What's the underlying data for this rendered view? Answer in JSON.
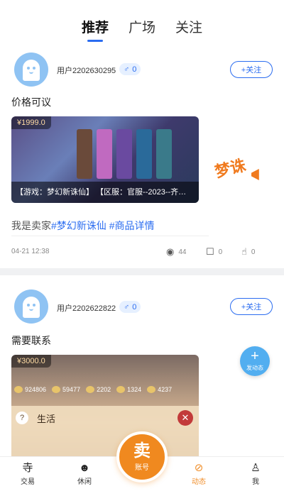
{
  "tabs": [
    {
      "label": "推荐",
      "active": true
    },
    {
      "label": "广场",
      "active": false
    },
    {
      "label": "关注",
      "active": false
    }
  ],
  "posts": [
    {
      "username": "用户2202630295",
      "gender_count": "0",
      "follow_label": "+关注",
      "title": "价格可议",
      "price": "¥1999.0",
      "banner": "【游戏：梦幻新诛仙】 【区服：官服--2023--齐…",
      "seller_text": "我是卖家",
      "tags": [
        "#梦幻新诛仙",
        "#商品详情"
      ],
      "date": "04-21 12:38",
      "views": "44",
      "comments": "0",
      "likes": "0"
    },
    {
      "username": "用户2202622822",
      "gender_count": "0",
      "follow_label": "+关注",
      "title": "需要联系",
      "price": "¥3000.0",
      "coins": [
        "924806",
        "59477",
        "2202",
        "1324",
        "4237"
      ],
      "panel_label": "生活"
    }
  ],
  "logo_text": "梦诛",
  "fab_label": "发动态",
  "bottom_nav": [
    {
      "label": "交易",
      "icon": "trade-icon",
      "glyph": "寺",
      "active": false
    },
    {
      "label": "休闲",
      "icon": "game-icon",
      "glyph": "☻",
      "active": false
    },
    {
      "label": "动态",
      "icon": "compass-icon",
      "glyph": "⊘",
      "active": true
    },
    {
      "label": "我",
      "icon": "person-icon",
      "glyph": "♙",
      "active": false
    }
  ],
  "sell_button": {
    "char": "卖",
    "sub": "账号"
  },
  "colors": {
    "accent": "#2a6cf0",
    "orange": "#f0891f",
    "fab": "#52aef0"
  }
}
